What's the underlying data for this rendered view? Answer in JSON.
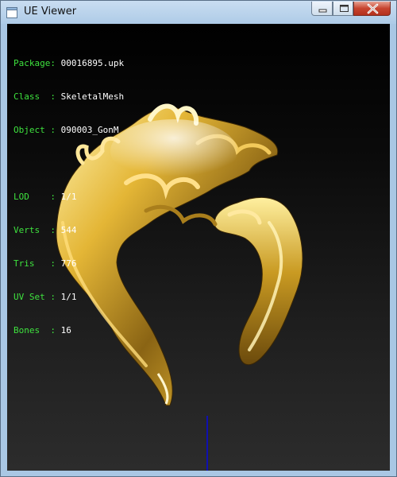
{
  "window": {
    "title": "UE Viewer",
    "icon": "app-window-icon",
    "controls": [
      "minimize-icon",
      "maximize-icon",
      "close-icon"
    ]
  },
  "info": {
    "package": {
      "key": "Package:",
      "value": "00016895.upk"
    },
    "class": {
      "key": "Class  :",
      "value": "SkeletalMesh"
    },
    "object": {
      "key": "Object :",
      "value": "090003_GonM"
    },
    "lod": {
      "key": "LOD    :",
      "value": "1/1"
    },
    "verts": {
      "key": "Verts  :",
      "value": "544"
    },
    "tris": {
      "key": "Tris   :",
      "value": "776"
    },
    "uvset": {
      "key": "UV Set :",
      "value": "1/1"
    },
    "bones": {
      "key": "Bones  :",
      "value": "16"
    }
  },
  "colors": {
    "label": "#3ee23e",
    "value": "#ffffff",
    "axis": "#1010b0",
    "mesh_gold": "#d8a928"
  }
}
